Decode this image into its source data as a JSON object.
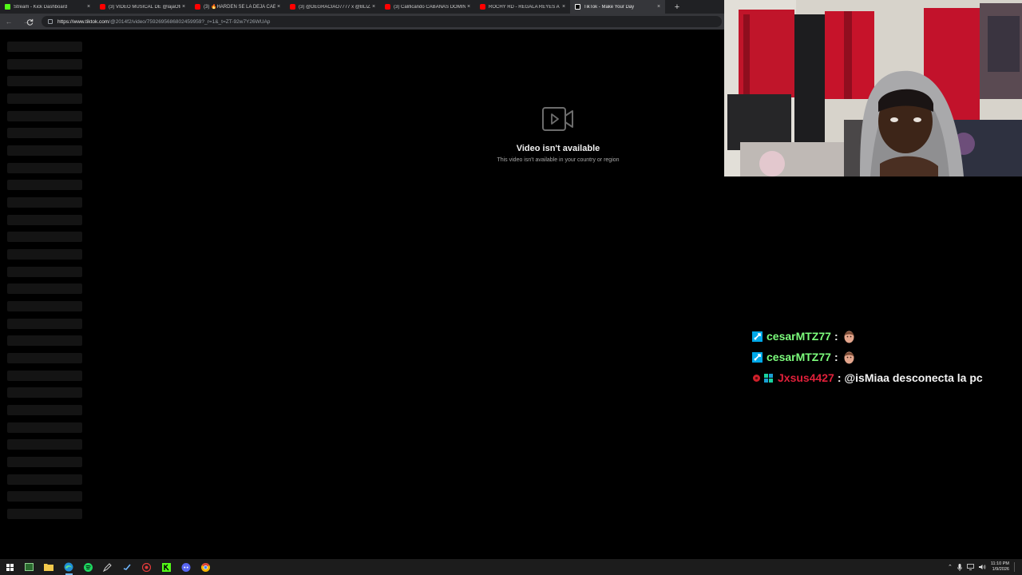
{
  "browser": {
    "tabs": [
      {
        "title": "Stream - Kick Dashboard",
        "favicon": "kick-icon",
        "color": "#53fc18",
        "active": false
      },
      {
        "title": "(3) VIDEO MUSICAL DE @lajaOfic",
        "favicon": "youtube-icon",
        "color": "#ff0000",
        "active": false
      },
      {
        "title": "(3) 🔥HARDEN SE LA DEJA CAER",
        "favicon": "youtube-icon",
        "color": "#ff0000",
        "active": false
      },
      {
        "title": "(3) @DEGRACIAO7777 x @BLIZZ",
        "favicon": "youtube-icon",
        "color": "#ff0000",
        "active": false
      },
      {
        "title": "(3) Calificando CABAÑAS DOMIN",
        "favicon": "youtube-icon",
        "color": "#ff0000",
        "active": false
      },
      {
        "title": "ROCHY RD - REGALA REYES A",
        "favicon": "youtube-icon",
        "color": "#ff0000",
        "active": false
      },
      {
        "title": "TikTok - Make Your Day",
        "favicon": "tiktok-icon",
        "color": "#ffffff",
        "active": true
      }
    ],
    "close_glyph": "×",
    "new_tab_glyph": "+",
    "url_host": "https://www.tiktok.com",
    "url_path": "/@2014f2/video/7592695686802459959?_r=1&_t=ZT-92w7Y26WUAp"
  },
  "page": {
    "unavailable_title": "Video isn't available",
    "unavailable_message": "This video isn't available in your country or region"
  },
  "chat": {
    "messages": [
      {
        "username": "cesarMTZ77",
        "separator": ":",
        "text": "",
        "name_color": "#7cfc7c",
        "badge": "moderator-sword-icon",
        "emote": "face-emote"
      },
      {
        "username": "cesarMTZ77",
        "separator": ":",
        "text": "",
        "name_color": "#7cfc7c",
        "badge": "moderator-sword-icon",
        "emote": "face-emote"
      },
      {
        "username": "Jxsus4427",
        "separator": ":",
        "text": "@isMiaa desconecta la pc",
        "name_color": "#e0203a",
        "badge": "subscriber-badge-icon",
        "emote": ""
      }
    ]
  },
  "taskbar": {
    "time": "11:10 PM",
    "date": "1/9/2026"
  },
  "colors": {
    "accent": "#76b9ed",
    "moderator_badge": "#00a8e8",
    "subscriber_badge": "#19d4a0"
  }
}
